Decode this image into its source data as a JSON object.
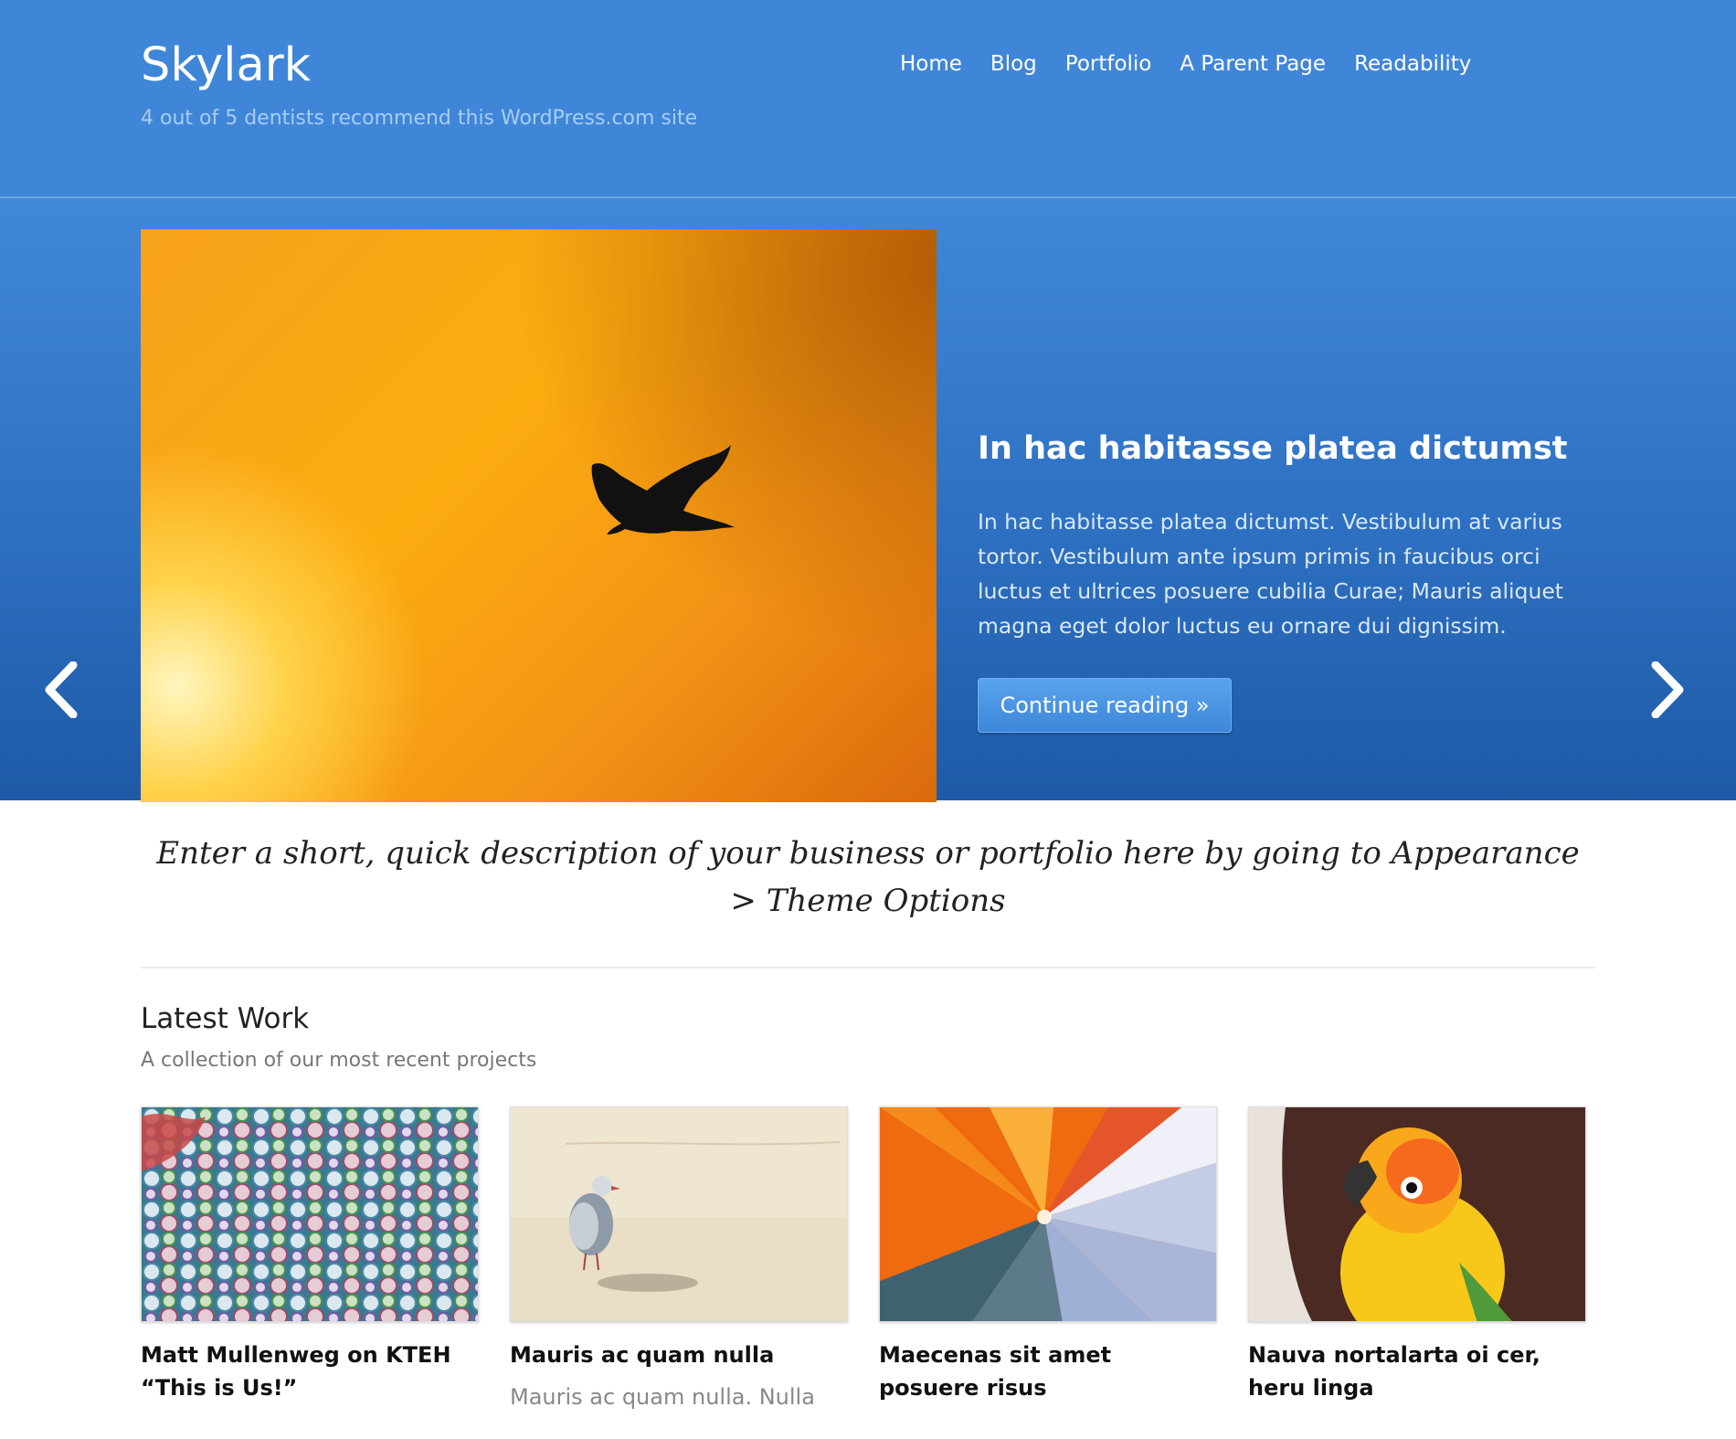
{
  "site": {
    "title": "Skylark",
    "tagline": "4 out of 5 dentists recommend this WordPress.com site"
  },
  "nav": {
    "items": [
      {
        "label": "Home"
      },
      {
        "label": "Blog"
      },
      {
        "label": "Portfolio"
      },
      {
        "label": "A Parent Page"
      },
      {
        "label": "Readability"
      }
    ]
  },
  "slider": {
    "image_icon": "bird-silhouette-sunset-photo",
    "title": "In hac habitasse platea dictumst",
    "text": "In hac habitasse platea dictumst. Vestibulum at varius tortor. Vestibulum ante ipsum primis in faucibus orci luctus et ultrices posuere cubilia Curae; Mauris aliquet magna eget dolor luctus eu ornare dui dignissim.",
    "button_label": "Continue reading »",
    "prev_icon": "chevron-left-icon",
    "next_icon": "chevron-right-icon"
  },
  "description": "Enter a short, quick description of your business or portfolio here by going to Appearance > Theme Options",
  "latest_work": {
    "title": "Latest Work",
    "subtitle": "A collection of our most recent projects",
    "items": [
      {
        "title": "Matt Mullenweg on KTEH “This is Us!”",
        "excerpt": "",
        "image": "wordpress-buttons-photo"
      },
      {
        "title": "Mauris ac quam nulla",
        "excerpt": "Mauris ac quam nulla. Nulla",
        "image": "seagull-on-beach-photo"
      },
      {
        "title": "Maecenas sit amet posuere risus",
        "excerpt": "",
        "image": "parachute-canopy-photo"
      },
      {
        "title": "Nauva nortalarta oi cer, heru linga",
        "excerpt": "",
        "image": "parrot-photo"
      }
    ]
  },
  "colors": {
    "header_bg": "#3f86d8",
    "hero_top": "#4188da",
    "hero_bottom": "#1e5aa6",
    "button": "#4a94e4"
  }
}
